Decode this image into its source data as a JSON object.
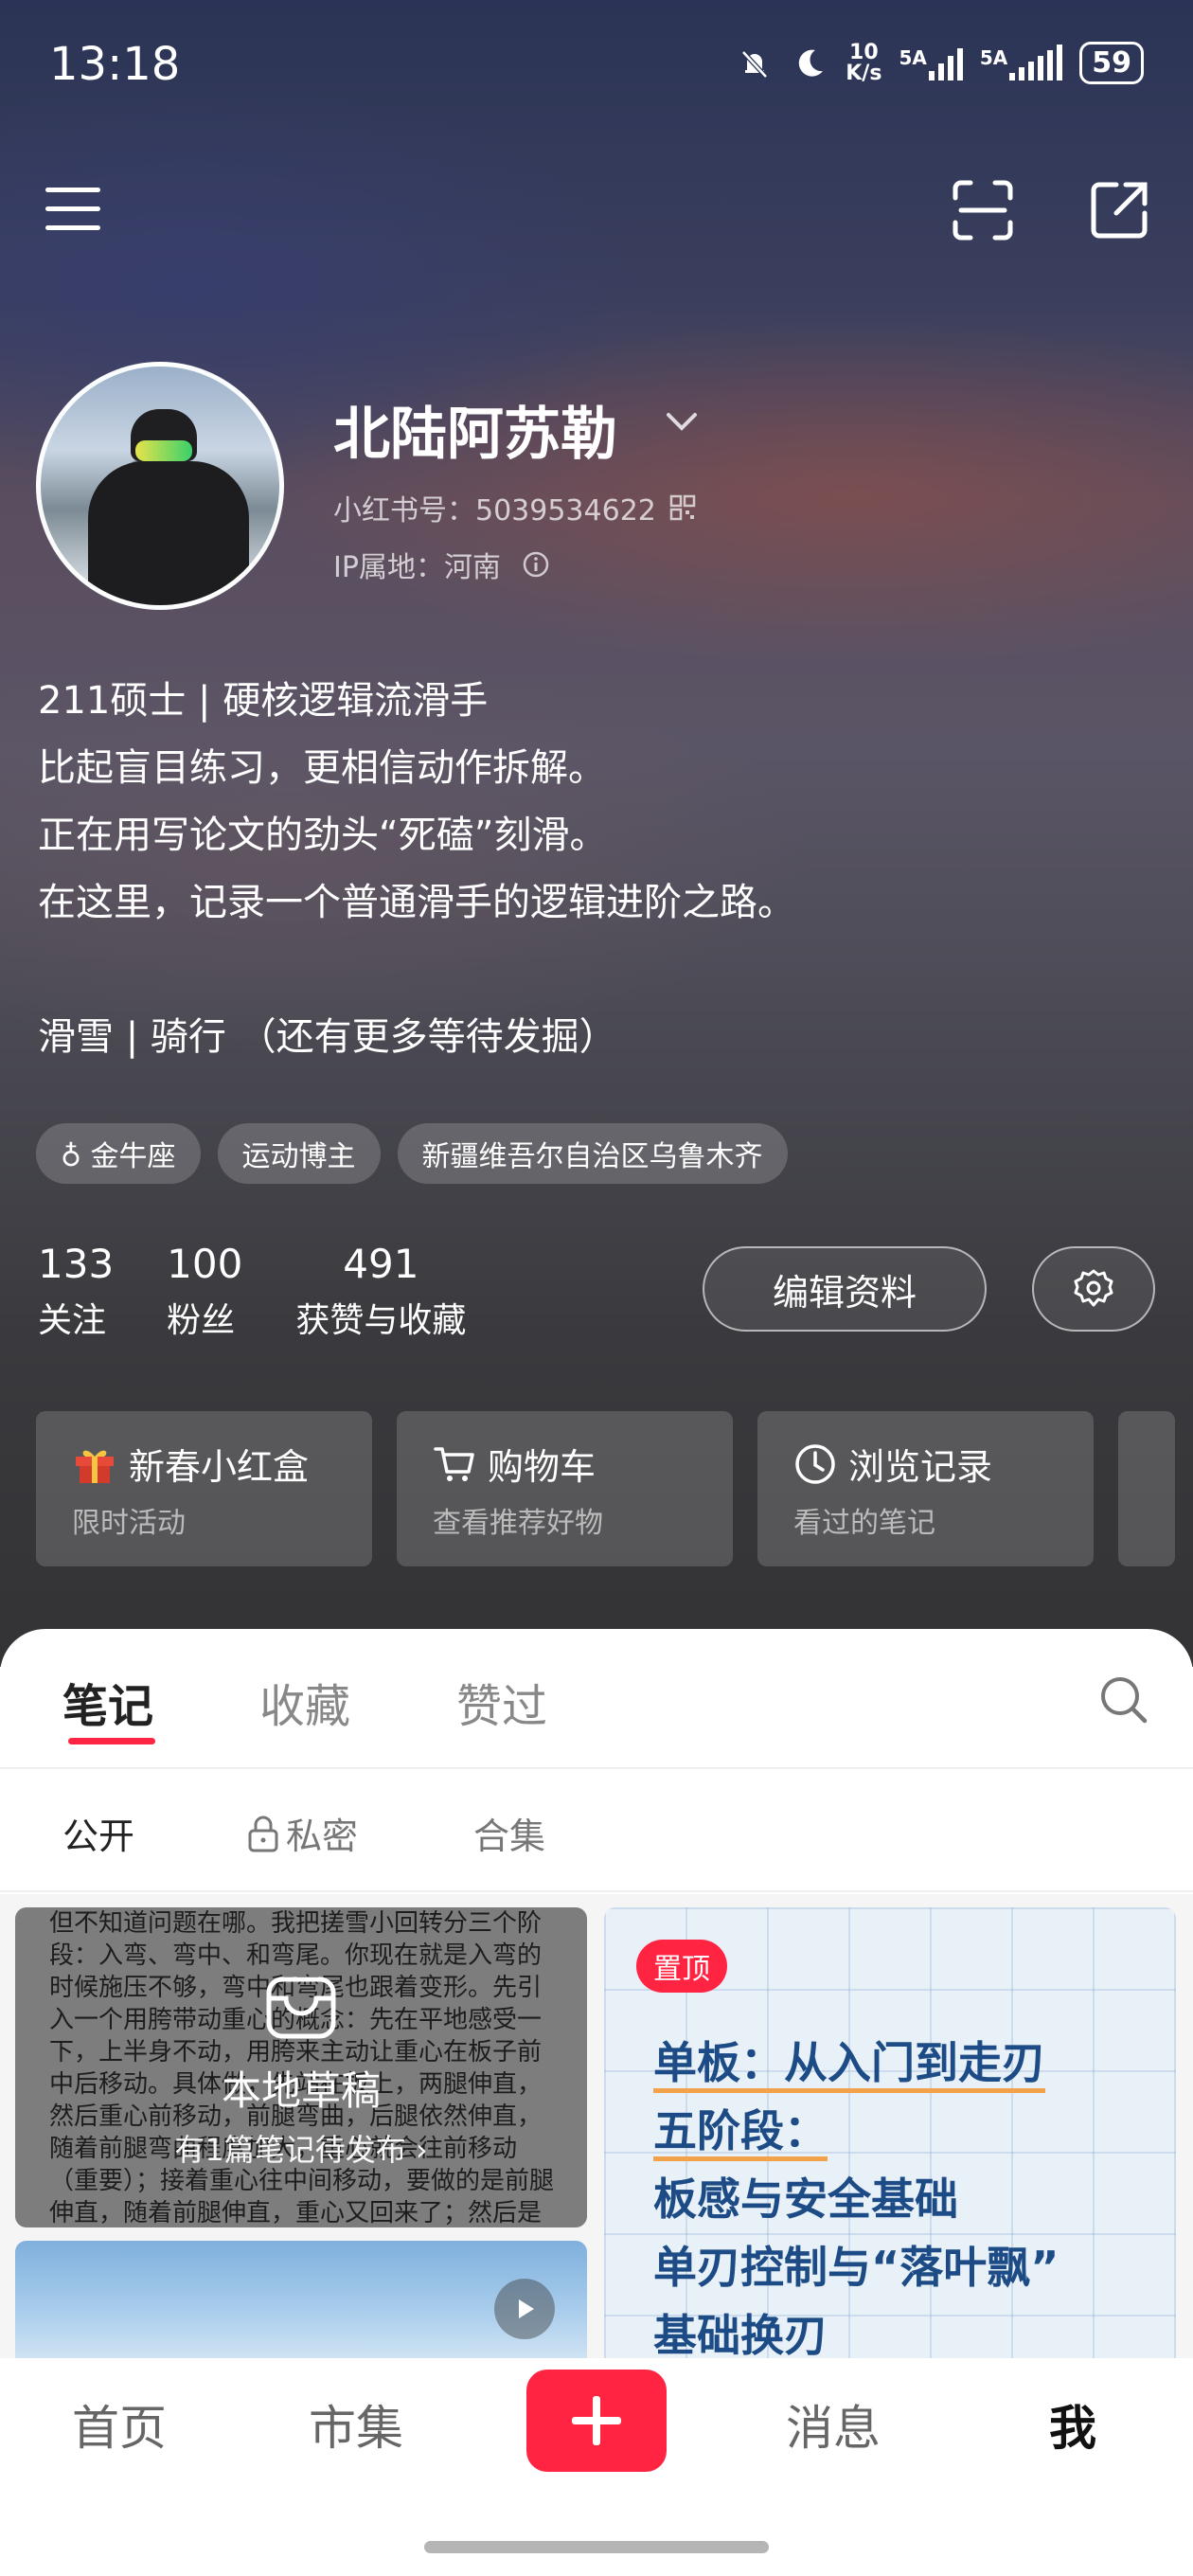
{
  "status_bar": {
    "time": "13:18",
    "net_speed": "10\nK/s",
    "sim1": "5A",
    "sim2": "5A",
    "battery": "59",
    "icons": [
      "bell-muted-icon",
      "moon-icon",
      "signal-icon",
      "signal-icon",
      "battery-icon"
    ]
  },
  "top_bar": {
    "icons": [
      "menu-icon",
      "scan-icon",
      "share-icon"
    ]
  },
  "profile": {
    "nickname": "北陆阿苏勒",
    "id_label": "小红书号：5039534622",
    "ip_label": "IP属地：河南",
    "bio_lines": [
      "211硕士 | 硬核逻辑流滑手",
      "比起盲目练习，更相信动作拆解。",
      "正在用写论文的劲头“死磕”刻滑。",
      "在这里，记录一个普通滑手的逻辑进阶之路。",
      "",
      "滑雪  |  骑行 （还有更多等待发掘）"
    ],
    "tags": [
      "♁ 金牛座",
      "运动博主",
      "新疆维吾尔自治区乌鲁木齐"
    ]
  },
  "stats": [
    {
      "num": "133",
      "label": "关注"
    },
    {
      "num": "100",
      "label": "粉丝"
    },
    {
      "num": "491",
      "label": "获赞与收藏"
    }
  ],
  "actions": {
    "edit_label": "编辑资料"
  },
  "feature_cards": [
    {
      "title": "新春小红盒",
      "subtitle": "限时活动",
      "icon": "gift-icon"
    },
    {
      "title": "购物车",
      "subtitle": "查看推荐好物",
      "icon": "cart-icon"
    },
    {
      "title": "浏览记录",
      "subtitle": "看过的笔记",
      "icon": "clock-icon"
    }
  ],
  "tabs": [
    "笔记",
    "收藏",
    "赞过"
  ],
  "subtabs": [
    "公开",
    "私密",
    "合集"
  ],
  "draft": {
    "preview_text": "但不知道问题在哪。我把搓雪小回转分三个阶段：入弯、弯中、和弯尾。你现在就是入弯的时候施压不够，弯中和弯尾也跟着变形。先引入一个用胯带动重心的概念：先在平地感受一下，上半身不动，用胯来主动让重心在板子前中后移动。具体做，先站在板上，两腿伸直，然后重心前移动，前腿弯曲，后腿依然伸直，随着前腿弯曲程度加大，重心就会往前移动（重要）；接着重心往中间移动，要做的是前腿伸直，随着前腿伸直，重心又回来了；然后是重心后移",
    "title": "本地草稿",
    "subtitle": "有1篇笔记待发布 ›"
  },
  "pinned_note": {
    "badge": "置顶",
    "lines": [
      "单板：从入门到走刃",
      "五阶段：",
      "板感与安全基础",
      "单刃控制与“落叶飘”",
      "基础换刃"
    ]
  },
  "bottom_nav": [
    "首页",
    "市集",
    "消息",
    "我"
  ],
  "colors": {
    "accent": "#ff2442",
    "pinned_text": "#1c4b86"
  }
}
